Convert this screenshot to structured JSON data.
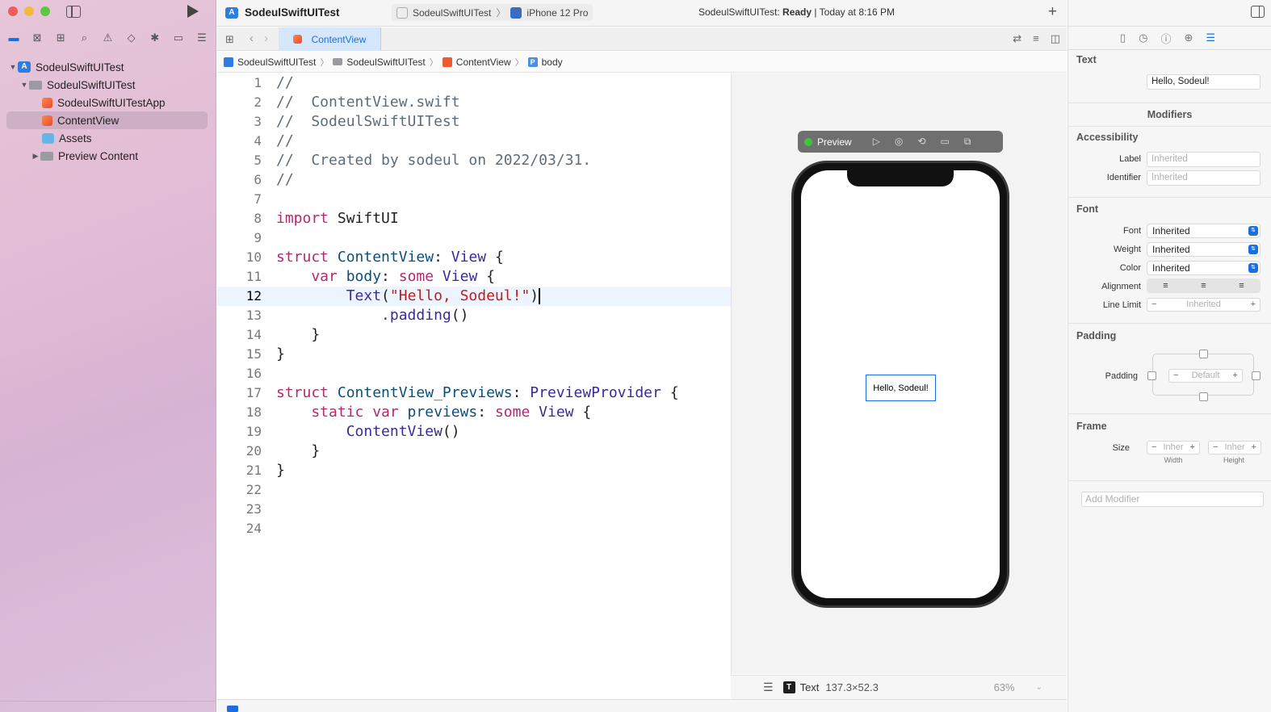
{
  "window": {
    "title": "SodeulSwiftUITest"
  },
  "toolbar": {
    "scheme_app": "SodeulSwiftUITest",
    "scheme_device": "iPhone 12 Pro",
    "status_prefix": "SodeulSwiftUITest: ",
    "status_state": "Ready",
    "status_time": " | Today at 8:16 PM",
    "add_label": "+"
  },
  "navigator": {
    "items": [
      {
        "label": "SodeulSwiftUITest"
      },
      {
        "label": "SodeulSwiftUITest"
      },
      {
        "label": "SodeulSwiftUITestApp"
      },
      {
        "label": "ContentView"
      },
      {
        "label": "Assets"
      },
      {
        "label": "Preview Content"
      }
    ]
  },
  "tab": {
    "label": "ContentView"
  },
  "jumpbar": [
    "SodeulSwiftUITest",
    "SodeulSwiftUITest",
    "ContentView",
    "body"
  ],
  "code": {
    "current_line": 12,
    "lines": [
      "1",
      "2",
      "3",
      "4",
      "5",
      "6",
      "7",
      "8",
      "9",
      "10",
      "11",
      "12",
      "13",
      "14",
      "15",
      "16",
      "17",
      "18",
      "19",
      "20",
      "21",
      "22",
      "23",
      "24"
    ],
    "l1": "//",
    "l2": "//  ContentView.swift",
    "l3": "//  SodeulSwiftUITest",
    "l4": "//",
    "l5": "//  Created by sodeul on 2022/03/31.",
    "l6": "//",
    "l8_kw": "import",
    "l8_rest": " SwiftUI",
    "l10_kw": "struct",
    "l10_name": " ContentView",
    "l10_colon": ": ",
    "l10_type": "View",
    "l10_brace": " {",
    "l11_kw": "    var",
    "l11_name": " body",
    "l11_colon": ": ",
    "l11_kw2": "some",
    "l11_type": " View",
    "l11_brace": " {",
    "l12_fn": "        Text",
    "l12_paren": "(",
    "l12_str": "\"Hello, Sodeul!\"",
    "l12_close": ")",
    "l13_fn": "            .padding",
    "l13_paren": "()",
    "l14": "    }",
    "l15": "}",
    "l17_kw": "struct",
    "l17_name": " ContentView_Previews",
    "l17_colon": ": ",
    "l17_type": "PreviewProvider",
    "l17_brace": " {",
    "l18_kw": "    static var",
    "l18_name": " previews",
    "l18_colon": ": ",
    "l18_kw2": "some",
    "l18_type": " View",
    "l18_brace": " {",
    "l19_fn": "        ContentView",
    "l19_paren": "()",
    "l20": "    }",
    "l21": "}"
  },
  "preview": {
    "button_label": "Preview",
    "device_text": "Hello, Sodeul!"
  },
  "canvas_footer": {
    "element_label": "Text",
    "size": "137.3×52.3",
    "zoom": "63%"
  },
  "inspector": {
    "text_title": "Text",
    "text_value": "Hello, Sodeul!",
    "modifiers_title": "Modifiers",
    "accessibility_title": "Accessibility",
    "label_label": "Label",
    "label_placeholder": "Inherited",
    "identifier_label": "Identifier",
    "identifier_placeholder": "Inherited",
    "font_title": "Font",
    "font_label": "Font",
    "font_value": "Inherited",
    "weight_label": "Weight",
    "weight_value": "Inherited",
    "color_label": "Color",
    "color_value": "Inherited",
    "alignment_label": "Alignment",
    "line_limit_label": "Line Limit",
    "line_limit_value": "Inherited",
    "padding_title": "Padding",
    "padding_label": "Padding",
    "padding_value": "Default",
    "frame_title": "Frame",
    "size_label": "Size",
    "width_value": "Inher",
    "height_value": "Inher",
    "width_caption": "Width",
    "height_caption": "Height",
    "add_modifier_placeholder": "Add Modifier"
  },
  "colors": {
    "accent": "#1a6fe0",
    "keyword": "#b2296d",
    "string": "#c41a16",
    "type": "#3b2a99"
  }
}
